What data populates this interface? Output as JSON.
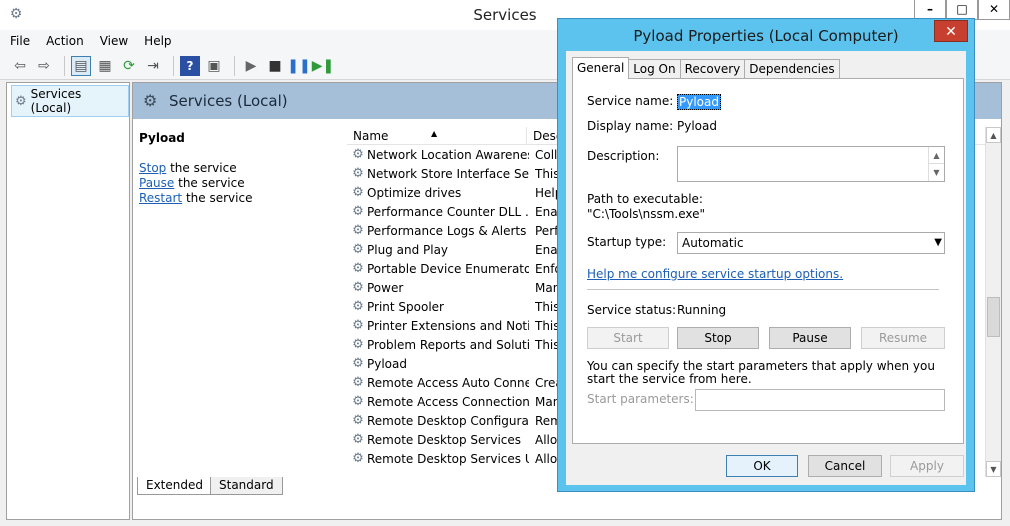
{
  "window": {
    "title": "Services",
    "minimize": "–",
    "maximize": "□",
    "close": "✕"
  },
  "menu": [
    "File",
    "Action",
    "View",
    "Help"
  ],
  "toolbar_icons": [
    "back-arrow-icon",
    "forward-arrow-icon",
    "console-tree-icon",
    "properties-icon",
    "refresh-icon",
    "export-icon",
    "help-icon",
    "mmc-icon",
    "play-icon",
    "stop-icon",
    "pause-icon",
    "restart-icon"
  ],
  "tree": {
    "item": "Services (Local)"
  },
  "main": {
    "header": "Services (Local)",
    "selected_service": "Pyload",
    "actions": [
      {
        "link": "Stop",
        "rest": " the service"
      },
      {
        "link": "Pause",
        "rest": " the service"
      },
      {
        "link": "Restart",
        "rest": " the service"
      }
    ],
    "columns": {
      "name": "Name",
      "desc": "Desc"
    },
    "rows": [
      {
        "name": "Network Location Awareness",
        "desc": "Colle"
      },
      {
        "name": "Network Store Interface Ser...",
        "desc": "This"
      },
      {
        "name": "Optimize drives",
        "desc": "Help"
      },
      {
        "name": "Performance Counter DLL ...",
        "desc": "Enab"
      },
      {
        "name": "Performance Logs & Alerts",
        "desc": "Perfo"
      },
      {
        "name": "Plug and Play",
        "desc": "Enab"
      },
      {
        "name": "Portable Device Enumerator...",
        "desc": "Enfo"
      },
      {
        "name": "Power",
        "desc": "Man"
      },
      {
        "name": "Print Spooler",
        "desc": "This"
      },
      {
        "name": "Printer Extensions and Notif...",
        "desc": "This"
      },
      {
        "name": "Problem Reports and Soluti...",
        "desc": "This"
      },
      {
        "name": "Pyload",
        "desc": ""
      },
      {
        "name": "Remote Access Auto Conne...",
        "desc": "Creat"
      },
      {
        "name": "Remote Access Connection...",
        "desc": "Man"
      },
      {
        "name": "Remote Desktop Configurat...",
        "desc": "Rem"
      },
      {
        "name": "Remote Desktop Services",
        "desc": "Allow"
      },
      {
        "name": "Remote Desktop Services U...",
        "desc": "Allow"
      }
    ],
    "bottom_tabs": [
      "Extended",
      "Standard"
    ]
  },
  "dialog": {
    "title": "Pyload Properties (Local Computer)",
    "close": "✕",
    "tabs": [
      "General",
      "Log On",
      "Recovery",
      "Dependencies"
    ],
    "service_name_label": "Service name:",
    "service_name": "Pyload",
    "display_name_label": "Display name:",
    "display_name": "Pyload",
    "description_label": "Description:",
    "path_label": "Path to executable:",
    "path": "\"C:\\Tools\\nssm.exe\"",
    "startup_type_label": "Startup type:",
    "startup_type": "Automatic",
    "help_link": "Help me configure service startup options.",
    "status_label": "Service status:",
    "status": "Running",
    "buttons": {
      "start": "Start",
      "stop": "Stop",
      "pause": "Pause",
      "resume": "Resume"
    },
    "param_hint": "You can specify the start parameters that apply when you start the service from here.",
    "param_label": "Start parameters:",
    "ok": "OK",
    "cancel": "Cancel",
    "apply": "Apply"
  }
}
